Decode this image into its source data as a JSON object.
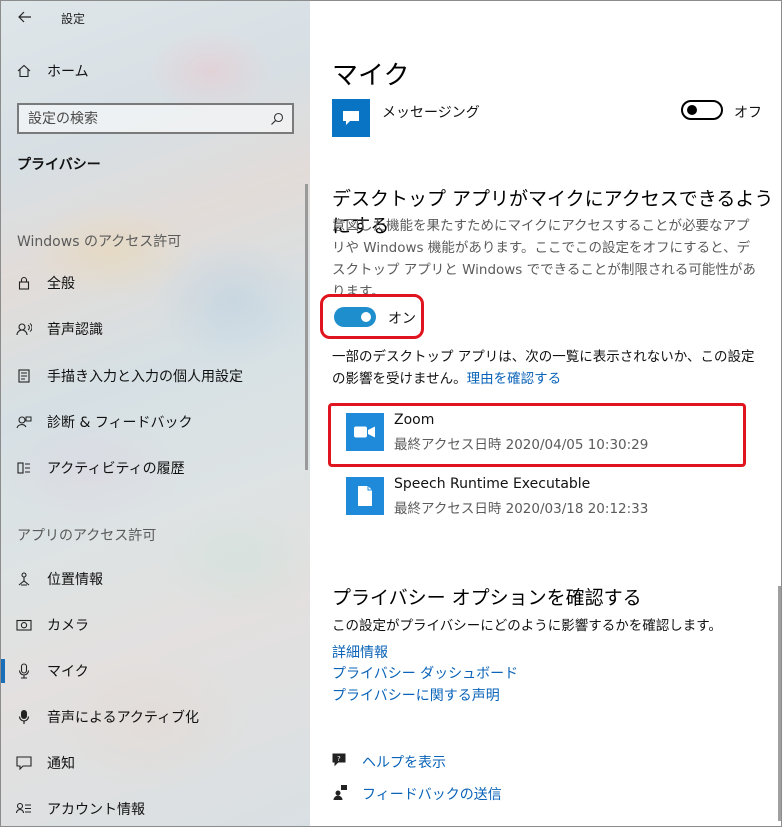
{
  "window": {
    "app_title": "設定",
    "minimize_glyph": "—",
    "maximize_glyph": "☐",
    "close_glyph": "✕"
  },
  "sidebar": {
    "home_label": "ホーム",
    "search_placeholder": "設定の検索",
    "section_title": "プライバシー",
    "group_windows": "Windows のアクセス許可",
    "windows_items": [
      {
        "icon": "lock-icon",
        "label": "全般"
      },
      {
        "icon": "speech-icon",
        "label": "音声認識"
      },
      {
        "icon": "handwriting-icon",
        "label": "手描き入力と入力の個人用設定"
      },
      {
        "icon": "feedback-icon",
        "label": "診断 & フィードバック"
      },
      {
        "icon": "timeline-icon",
        "label": "アクティビティの履歴"
      }
    ],
    "group_apps": "アプリのアクセス許可",
    "app_items": [
      {
        "icon": "location-icon",
        "label": "位置情報"
      },
      {
        "icon": "camera-icon",
        "label": "カメラ"
      },
      {
        "icon": "microphone-icon",
        "label": "マイク"
      },
      {
        "icon": "voice-activation-icon",
        "label": "音声によるアクティブ化"
      },
      {
        "icon": "notification-icon",
        "label": "通知"
      },
      {
        "icon": "account-info-icon",
        "label": "アカウント情報"
      }
    ],
    "active_item": "マイク"
  },
  "main": {
    "page_title": "マイク",
    "messaging": {
      "label": "メッセージング",
      "toggle_state": "オフ"
    },
    "desktop_section": {
      "heading": "デスクトップ アプリがマイクにアクセスできるようにする",
      "description": "意図した機能を果たすためにマイクにアクセスすることが必要なアプリや Windows 機能があります。ここでこの設定をオフにすると、デスクトップ アプリと Windows でできることが制限される可能性があります。",
      "toggle_state": "オン",
      "note": "一部のデスクトップ アプリは、次の一覧に表示されないか、この設定の影響を受けません。",
      "note_link": "理由を確認する"
    },
    "apps": [
      {
        "name": "Zoom",
        "meta": "最終アクセス日時 2020/04/05 10:30:29"
      },
      {
        "name": "Speech Runtime Executable",
        "meta": "最終アクセス日時 2020/03/18 20:12:33"
      }
    ],
    "privacy_section": {
      "heading": "プライバシー オプションを確認する",
      "description": "この設定がプライバシーにどのように影響するかを確認します。",
      "links": [
        "詳細情報",
        "プライバシー ダッシュボード",
        "プライバシーに関する声明"
      ]
    },
    "help": {
      "show_help": "ヘルプを表示",
      "send_feedback": "フィードバックの送信"
    }
  },
  "colors": {
    "accent": "#1e8ecd",
    "link": "#0a63b8",
    "highlight": "#e0141e"
  }
}
